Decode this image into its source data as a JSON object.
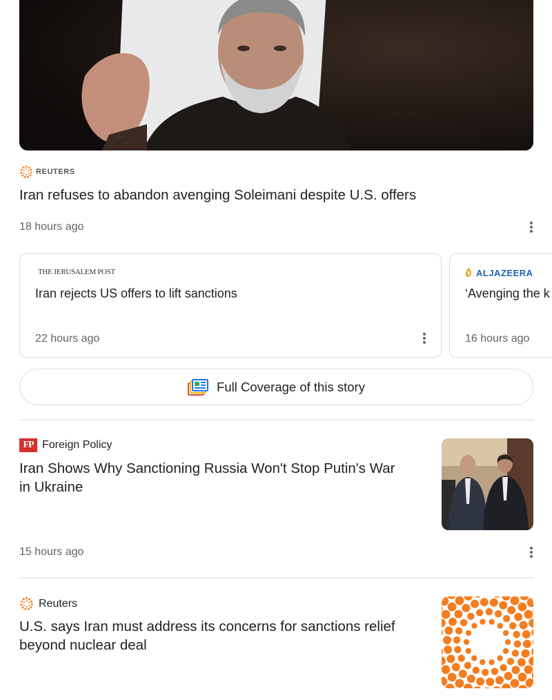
{
  "top_story": {
    "source_logo_text": "REUTERS",
    "headline": "Iran refuses to abandon avenging Soleimani despite U.S. offers",
    "time": "18 hours ago"
  },
  "related_cards": [
    {
      "source_logo_text": "THE JERUSALEM POST",
      "title": "Iran rejects US offers to lift sanctions",
      "time": "22 hours ago"
    },
    {
      "source_logo_text": "ALJAZEERA",
      "title": "‘Avenging the k",
      "time": "16 hours ago"
    }
  ],
  "full_coverage": {
    "label": "Full Coverage of this story"
  },
  "articles": [
    {
      "source_logo_text": "FP",
      "source": "Foreign Policy",
      "headline_line1": "Iran Shows Why Sanctioning Russia Won't Stop Putin's War",
      "headline_line2": "in Ukraine",
      "time": "15 hours ago"
    },
    {
      "source": "Reuters",
      "headline_line1": "U.S. says Iran must address its concerns for sanctions relief",
      "headline_line2": "beyond nuclear deal"
    }
  ],
  "colors": {
    "reuters_orange": "#f47d20",
    "fp_red": "#d6302e",
    "aljazeera_gold": "#e8a317",
    "aljazeera_blue": "#1f5fb0",
    "text_primary": "#202124",
    "text_secondary": "#5f6368",
    "border": "#dadce0"
  },
  "icons": {
    "kebab": "more-vert-icon",
    "full_coverage": "full-coverage-icon"
  }
}
